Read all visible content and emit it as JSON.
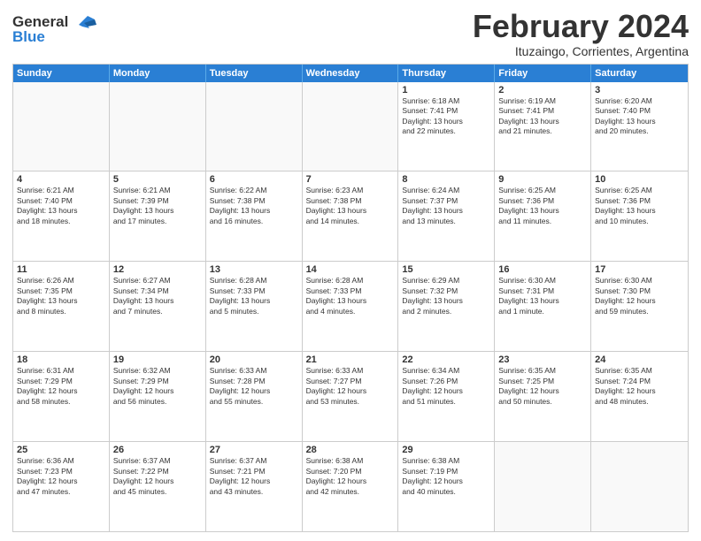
{
  "logo": {
    "line1": "General",
    "line2": "Blue"
  },
  "title": "February 2024",
  "subtitle": "Ituzaingo, Corrientes, Argentina",
  "header_days": [
    "Sunday",
    "Monday",
    "Tuesday",
    "Wednesday",
    "Thursday",
    "Friday",
    "Saturday"
  ],
  "rows": [
    [
      {
        "day": "",
        "info": ""
      },
      {
        "day": "",
        "info": ""
      },
      {
        "day": "",
        "info": ""
      },
      {
        "day": "",
        "info": ""
      },
      {
        "day": "1",
        "info": "Sunrise: 6:18 AM\nSunset: 7:41 PM\nDaylight: 13 hours\nand 22 minutes."
      },
      {
        "day": "2",
        "info": "Sunrise: 6:19 AM\nSunset: 7:41 PM\nDaylight: 13 hours\nand 21 minutes."
      },
      {
        "day": "3",
        "info": "Sunrise: 6:20 AM\nSunset: 7:40 PM\nDaylight: 13 hours\nand 20 minutes."
      }
    ],
    [
      {
        "day": "4",
        "info": "Sunrise: 6:21 AM\nSunset: 7:40 PM\nDaylight: 13 hours\nand 18 minutes."
      },
      {
        "day": "5",
        "info": "Sunrise: 6:21 AM\nSunset: 7:39 PM\nDaylight: 13 hours\nand 17 minutes."
      },
      {
        "day": "6",
        "info": "Sunrise: 6:22 AM\nSunset: 7:38 PM\nDaylight: 13 hours\nand 16 minutes."
      },
      {
        "day": "7",
        "info": "Sunrise: 6:23 AM\nSunset: 7:38 PM\nDaylight: 13 hours\nand 14 minutes."
      },
      {
        "day": "8",
        "info": "Sunrise: 6:24 AM\nSunset: 7:37 PM\nDaylight: 13 hours\nand 13 minutes."
      },
      {
        "day": "9",
        "info": "Sunrise: 6:25 AM\nSunset: 7:36 PM\nDaylight: 13 hours\nand 11 minutes."
      },
      {
        "day": "10",
        "info": "Sunrise: 6:25 AM\nSunset: 7:36 PM\nDaylight: 13 hours\nand 10 minutes."
      }
    ],
    [
      {
        "day": "11",
        "info": "Sunrise: 6:26 AM\nSunset: 7:35 PM\nDaylight: 13 hours\nand 8 minutes."
      },
      {
        "day": "12",
        "info": "Sunrise: 6:27 AM\nSunset: 7:34 PM\nDaylight: 13 hours\nand 7 minutes."
      },
      {
        "day": "13",
        "info": "Sunrise: 6:28 AM\nSunset: 7:33 PM\nDaylight: 13 hours\nand 5 minutes."
      },
      {
        "day": "14",
        "info": "Sunrise: 6:28 AM\nSunset: 7:33 PM\nDaylight: 13 hours\nand 4 minutes."
      },
      {
        "day": "15",
        "info": "Sunrise: 6:29 AM\nSunset: 7:32 PM\nDaylight: 13 hours\nand 2 minutes."
      },
      {
        "day": "16",
        "info": "Sunrise: 6:30 AM\nSunset: 7:31 PM\nDaylight: 13 hours\nand 1 minute."
      },
      {
        "day": "17",
        "info": "Sunrise: 6:30 AM\nSunset: 7:30 PM\nDaylight: 12 hours\nand 59 minutes."
      }
    ],
    [
      {
        "day": "18",
        "info": "Sunrise: 6:31 AM\nSunset: 7:29 PM\nDaylight: 12 hours\nand 58 minutes."
      },
      {
        "day": "19",
        "info": "Sunrise: 6:32 AM\nSunset: 7:29 PM\nDaylight: 12 hours\nand 56 minutes."
      },
      {
        "day": "20",
        "info": "Sunrise: 6:33 AM\nSunset: 7:28 PM\nDaylight: 12 hours\nand 55 minutes."
      },
      {
        "day": "21",
        "info": "Sunrise: 6:33 AM\nSunset: 7:27 PM\nDaylight: 12 hours\nand 53 minutes."
      },
      {
        "day": "22",
        "info": "Sunrise: 6:34 AM\nSunset: 7:26 PM\nDaylight: 12 hours\nand 51 minutes."
      },
      {
        "day": "23",
        "info": "Sunrise: 6:35 AM\nSunset: 7:25 PM\nDaylight: 12 hours\nand 50 minutes."
      },
      {
        "day": "24",
        "info": "Sunrise: 6:35 AM\nSunset: 7:24 PM\nDaylight: 12 hours\nand 48 minutes."
      }
    ],
    [
      {
        "day": "25",
        "info": "Sunrise: 6:36 AM\nSunset: 7:23 PM\nDaylight: 12 hours\nand 47 minutes."
      },
      {
        "day": "26",
        "info": "Sunrise: 6:37 AM\nSunset: 7:22 PM\nDaylight: 12 hours\nand 45 minutes."
      },
      {
        "day": "27",
        "info": "Sunrise: 6:37 AM\nSunset: 7:21 PM\nDaylight: 12 hours\nand 43 minutes."
      },
      {
        "day": "28",
        "info": "Sunrise: 6:38 AM\nSunset: 7:20 PM\nDaylight: 12 hours\nand 42 minutes."
      },
      {
        "day": "29",
        "info": "Sunrise: 6:38 AM\nSunset: 7:19 PM\nDaylight: 12 hours\nand 40 minutes."
      },
      {
        "day": "",
        "info": ""
      },
      {
        "day": "",
        "info": ""
      }
    ]
  ]
}
